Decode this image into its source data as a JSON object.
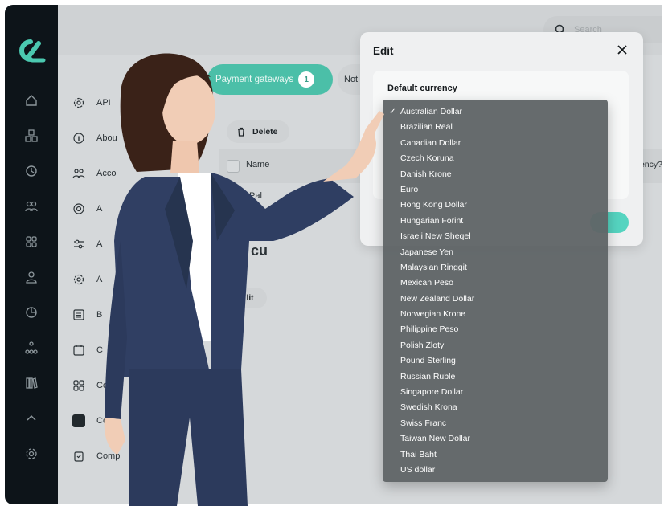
{
  "search": {
    "placeholder": "Search"
  },
  "settings_menu": [
    {
      "label": "API",
      "icon": "gear-icon"
    },
    {
      "label": "Abou",
      "icon": "info-icon"
    },
    {
      "label": "Acco",
      "icon": "users-icon"
    },
    {
      "label": "A",
      "icon": "target-icon"
    },
    {
      "label": "A",
      "icon": "sliders-icon"
    },
    {
      "label": "A",
      "icon": "gear-icon"
    },
    {
      "label": "B",
      "icon": "list-icon"
    },
    {
      "label": "C",
      "icon": "calendar-icon"
    },
    {
      "label": "Co",
      "icon": "grid-icon"
    },
    {
      "label": "Co",
      "icon": "square-icon"
    },
    {
      "label": "Comp",
      "icon": "clipboard-icon"
    }
  ],
  "tabs": {
    "active_label": "Payment gateways",
    "active_count": "1",
    "second_label": "Not"
  },
  "toolbar": {
    "delete_label": "Delete"
  },
  "table": {
    "col_name": "Name",
    "col_currency": "ency?",
    "row1_name": "Pal"
  },
  "section": {
    "title": "lt cu",
    "subtitle": "r",
    "edit_label": "lit"
  },
  "modal": {
    "title": "Edit",
    "field_label": "Default currency",
    "close_icon": "close-icon"
  },
  "currency_dropdown": {
    "selected": "Australian Dollar",
    "options": [
      "Australian Dollar",
      "Brazilian Real",
      "Canadian Dollar",
      "Czech Koruna",
      "Danish Krone",
      "Euro",
      "Hong Kong Dollar",
      "Hungarian Forint",
      "Israeli New Sheqel",
      "Japanese Yen",
      "Malaysian Ringgit",
      "Mexican Peso",
      "New Zealand Dollar",
      "Norwegian Krone",
      "Philippine Peso",
      "Polish Zloty",
      "Pound Sterling",
      "Russian Ruble",
      "Singapore Dollar",
      "Swedish Krona",
      "Swiss Franc",
      "Taiwan New Dollar",
      "Thai Baht",
      "US dollar"
    ]
  },
  "colors": {
    "accent": "#4bbfa8",
    "rail": "#0d1419",
    "dropdown": "#5f6466"
  }
}
